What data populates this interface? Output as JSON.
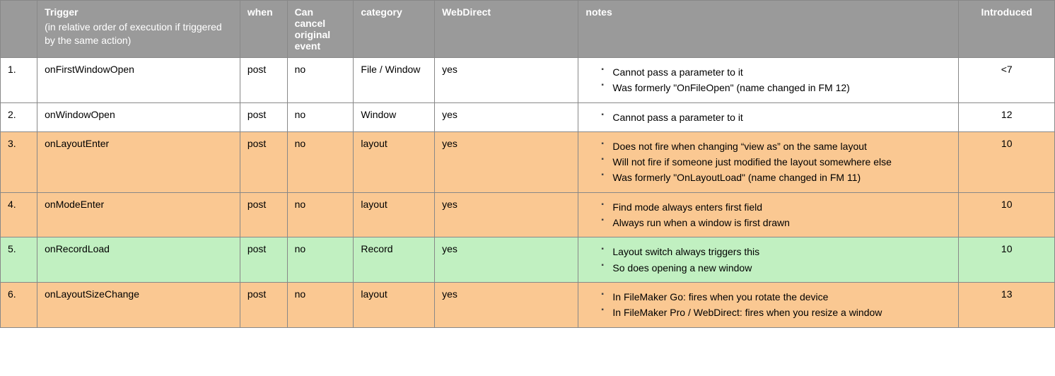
{
  "headers": {
    "num": "",
    "trigger": "Trigger",
    "trigger_sub": "(in relative order of execution if triggered by the same action)",
    "when": "when",
    "cancel": "Can cancel original event",
    "category": "category",
    "webdirect": "WebDirect",
    "notes": "notes",
    "introduced": "Introduced"
  },
  "rows": [
    {
      "num": "1.",
      "trigger": "onFirstWindowOpen",
      "when": "post",
      "cancel": "no",
      "category": "File / Window",
      "webdirect": "yes",
      "notes": [
        "Cannot pass a parameter to it",
        "Was formerly \"OnFileOpen\" (name changed in FM 12)"
      ],
      "introduced": "<7",
      "bg": "white"
    },
    {
      "num": "2.",
      "trigger": "onWindowOpen",
      "when": "post",
      "cancel": "no",
      "category": "Window",
      "webdirect": "yes",
      "notes": [
        "Cannot pass a parameter to it"
      ],
      "introduced": "12",
      "bg": "white"
    },
    {
      "num": "3.",
      "trigger": "onLayoutEnter",
      "when": "post",
      "cancel": "no",
      "category": "layout",
      "webdirect": "yes",
      "notes": [
        "Does not fire when changing “view as” on the same layout",
        "Will not fire if someone just modified the layout somewhere else",
        "Was formerly \"OnLayoutLoad\" (name changed in FM 11)"
      ],
      "introduced": "10",
      "bg": "orange"
    },
    {
      "num": "4.",
      "trigger": "onModeEnter",
      "when": "post",
      "cancel": "no",
      "category": "layout",
      "webdirect": "yes",
      "notes": [
        "Find mode always enters first field",
        "Always run when a window is first drawn"
      ],
      "introduced": "10",
      "bg": "orange"
    },
    {
      "num": "5.",
      "trigger": "onRecordLoad",
      "when": "post",
      "cancel": "no",
      "category": "Record",
      "webdirect": "yes",
      "notes": [
        "Layout switch always triggers this",
        "So does opening a new window"
      ],
      "introduced": "10",
      "bg": "green"
    },
    {
      "num": "6.",
      "trigger": "onLayoutSizeChange",
      "when": "post",
      "cancel": "no",
      "category": "layout",
      "webdirect": "yes",
      "notes": [
        "In FileMaker Go: fires when you rotate the device",
        "In FileMaker Pro / WebDirect: fires when you resize a window"
      ],
      "introduced": "13",
      "bg": "orange"
    }
  ]
}
